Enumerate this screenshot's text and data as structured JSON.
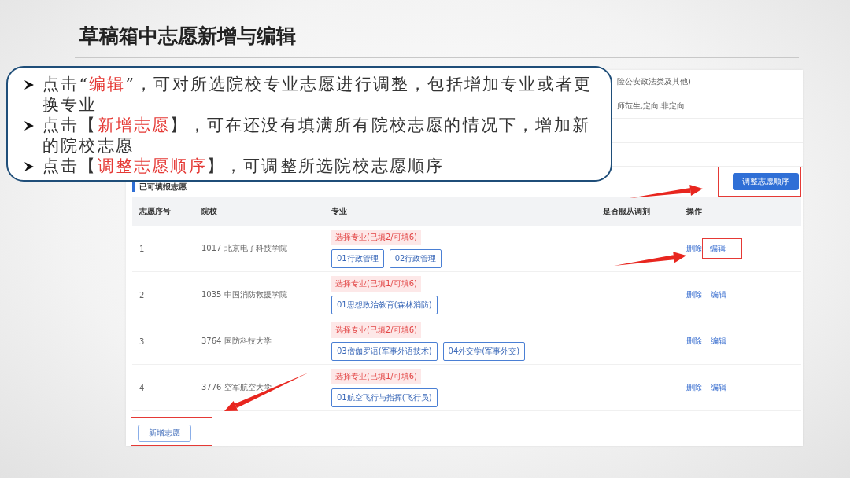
{
  "slide_title": "草稿箱中志愿新增与编辑",
  "callout": [
    {
      "segments": [
        {
          "text": "点击“",
          "highlight": false
        },
        {
          "text": "编辑",
          "highlight": true
        },
        {
          "text": "”，可对所选院校专业志愿进行调整，包括增加专业或者更换专业",
          "highlight": false
        }
      ]
    },
    {
      "segments": [
        {
          "text": "点击【",
          "highlight": false
        },
        {
          "text": "新增志愿",
          "highlight": true
        },
        {
          "text": "】，可在还没有填满所有院校志愿的情况下，增加新的院校志愿",
          "highlight": false
        }
      ]
    },
    {
      "segments": [
        {
          "text": "点击【",
          "highlight": false
        },
        {
          "text": "调整志愿顺序",
          "highlight": true
        },
        {
          "text": "】，可调整所选院校志愿顺序",
          "highlight": false
        }
      ]
    }
  ],
  "form_rows": [
    {
      "value": "险公安政法类及其他)"
    },
    {
      "value": "师范生,定向,非定向"
    }
  ],
  "section_title": "已可填报志愿",
  "reorder_button": {
    "label": "调整志愿顺序",
    "highlighted": true
  },
  "table": {
    "columns": [
      "志愿序号",
      "院校",
      "专业",
      "是否服从调剂",
      "操作"
    ],
    "rows": [
      {
        "index": "1",
        "school": "1017 北京电子科技学院",
        "picker": "选择专业(已填2/可填6)",
        "majors": [
          "01行政管理",
          "02行政管理"
        ],
        "delete": "删除",
        "edit": "编辑",
        "edit_highlighted": true
      },
      {
        "index": "2",
        "school": "1035 中国消防救援学院",
        "picker": "选择专业(已填1/可填6)",
        "majors": [
          "01思想政治教育(森林消防)"
        ],
        "delete": "删除",
        "edit": "编辑",
        "edit_highlighted": false
      },
      {
        "index": "3",
        "school": "3764 国防科技大学",
        "picker": "选择专业(已填2/可填6)",
        "majors": [
          "03僧伽罗语(军事外语技术)",
          "04外交学(军事外交)"
        ],
        "delete": "删除",
        "edit": "编辑",
        "edit_highlighted": false
      },
      {
        "index": "4",
        "school": "3776 空军航空大学",
        "picker": "选择专业(已填1/可填6)",
        "majors": [
          "01航空飞行与指挥(飞行员)"
        ],
        "delete": "删除",
        "edit": "编辑",
        "edit_highlighted": false
      }
    ]
  },
  "add_button": {
    "label": "新增志愿",
    "highlighted": true
  }
}
